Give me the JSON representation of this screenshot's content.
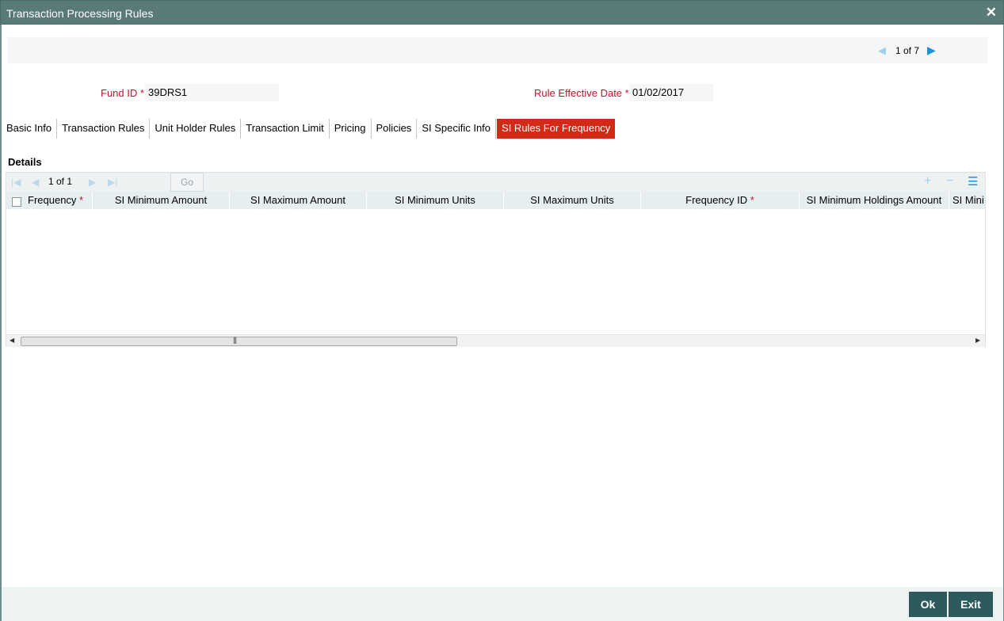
{
  "window": {
    "title": "Transaction Processing Rules",
    "close_icon": "close-icon"
  },
  "record_pager": {
    "text": "1 of 7",
    "prev_icon": "previous-record-icon",
    "next_icon": "next-record-icon"
  },
  "header": {
    "fund_id_label": "Fund ID *",
    "fund_id_value": "39DRS1",
    "rule_effective_date_label": "Rule Effective Date *",
    "rule_effective_date_value": "01/02/2017"
  },
  "tabs": [
    {
      "label": "Basic Info",
      "active": false
    },
    {
      "label": "Transaction Rules",
      "active": false
    },
    {
      "label": "Unit Holder Rules",
      "active": false
    },
    {
      "label": "Transaction Limit",
      "active": false
    },
    {
      "label": "Pricing",
      "active": false
    },
    {
      "label": "Policies",
      "active": false
    },
    {
      "label": "SI Specific Info",
      "active": false
    },
    {
      "label": "SI Rules For Frequency",
      "active": true
    }
  ],
  "details": {
    "title": "Details",
    "pager_text": "1 of 1",
    "go_label": "Go",
    "columns": [
      {
        "label": "Frequency",
        "required": true
      },
      {
        "label": "SI Minimum Amount",
        "required": false
      },
      {
        "label": "SI Maximum Amount",
        "required": false
      },
      {
        "label": "SI Minimum Units",
        "required": false
      },
      {
        "label": "SI Maximum Units",
        "required": false
      },
      {
        "label": "Frequency ID",
        "required": true
      },
      {
        "label": "SI Minimum Holdings Amount",
        "required": false
      },
      {
        "label": "SI Mini",
        "required": false
      }
    ],
    "required_mark": "*",
    "rows": []
  },
  "footer": {
    "ok_label": "Ok",
    "exit_label": "Exit"
  },
  "colors": {
    "titlebar": "#5a7a7a",
    "active_tab": "#d12a17",
    "label_red": "#c2132b",
    "button": "#2d5a5c",
    "nav_arrow": "#1a93d6"
  }
}
